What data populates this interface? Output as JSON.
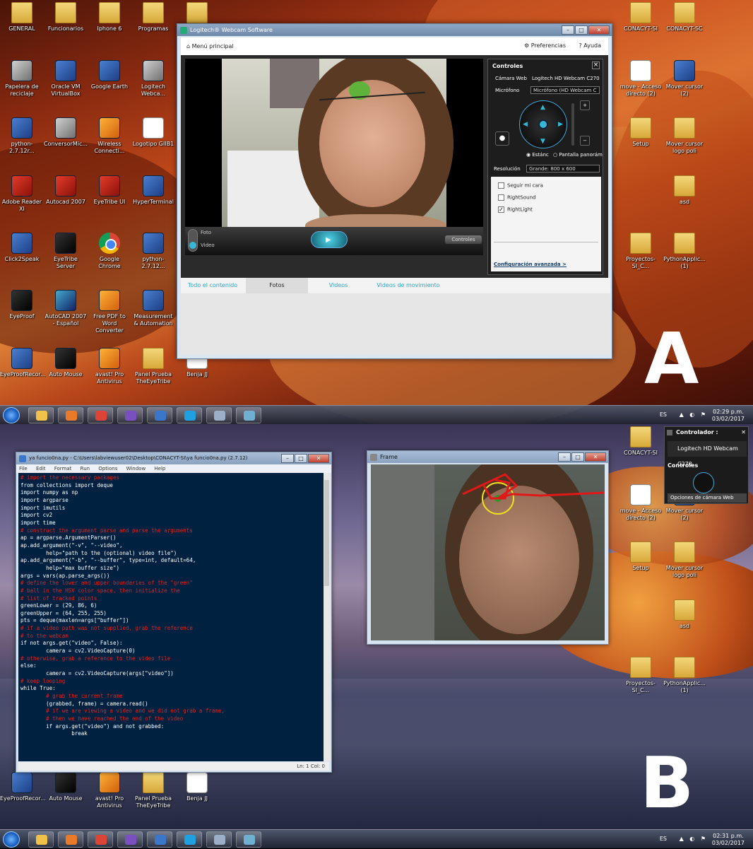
{
  "panel_a": {
    "label": "A",
    "desktop_icons": [
      {
        "label": "GENERAL",
        "type": "folder"
      },
      {
        "label": "Funcionarios",
        "type": "folder"
      },
      {
        "label": "Iphone 6",
        "type": "folder"
      },
      {
        "label": "Programas",
        "type": "folder"
      },
      {
        "label": "",
        "type": "folder"
      },
      {
        "label": "Papelera de reciclaje",
        "type": "gray"
      },
      {
        "label": "Oracle VM VirtualBox",
        "type": "app"
      },
      {
        "label": "Google Earth",
        "type": "app"
      },
      {
        "label": "Logitech Webca...",
        "type": "gray"
      },
      {
        "label": "python-2.7.12r...",
        "type": "app"
      },
      {
        "label": "ConversorMic...",
        "type": "gray"
      },
      {
        "label": "Wireless Connecti...",
        "type": "orange"
      },
      {
        "label": "Logotipo GIIB1",
        "type": "doc"
      },
      {
        "label": "Adobe Reader XI",
        "type": "red"
      },
      {
        "label": "Autocad 2007",
        "type": "red"
      },
      {
        "label": "EyeTribe UI",
        "type": "red"
      },
      {
        "label": "HyperTerminal",
        "type": "app"
      },
      {
        "label": "Click2Speak",
        "type": "app"
      },
      {
        "label": "EyeTribe Server",
        "type": "dark"
      },
      {
        "label": "Google Chrome",
        "type": "chrome"
      },
      {
        "label": "python-2.7.12...",
        "type": "app"
      },
      {
        "label": "EyeProof",
        "type": "dark"
      },
      {
        "label": "AutoCAD 2007 - Español",
        "type": "teal"
      },
      {
        "label": "Free PDF to Word Converter",
        "type": "orange"
      },
      {
        "label": "Measurement & Automation",
        "type": "app"
      },
      {
        "label": "EyeProofRecor...",
        "type": "app"
      },
      {
        "label": "Auto Mouse",
        "type": "dark"
      },
      {
        "label": "avast! Pro Antivirus",
        "type": "orange"
      },
      {
        "label": "Panel Prueba TheEyeTribe",
        "type": "folder"
      },
      {
        "label": "Benja JJ",
        "type": "doc"
      },
      {
        "label": "CONACYT-SI",
        "type": "folder"
      },
      {
        "label": "CONACYT-SC",
        "type": "folder"
      },
      {
        "label": "move - Acceso directo (2)",
        "type": "doc"
      },
      {
        "label": "Mover cursor (2)",
        "type": "app"
      },
      {
        "label": "Setup",
        "type": "folder"
      },
      {
        "label": "Mover cursor logo poli",
        "type": "folder"
      },
      {
        "label": "asd",
        "type": "folder"
      },
      {
        "label": "Proyectos-SI_C...",
        "type": "folder"
      },
      {
        "label": "PythonApplic... (1)",
        "type": "folder"
      }
    ],
    "logitech": {
      "title": "Logitech® Webcam Software",
      "menu_home": "Menú principal",
      "preferences": "Preferencias",
      "help": "Ayuda",
      "mode_photo": "Foto",
      "mode_video": "Video",
      "controls_button": "Controles",
      "controls_panel": {
        "title": "Controles",
        "camera_label": "Cámara Web",
        "camera_value": "Logitech HD Webcam C270",
        "mic_label": "Micrófono",
        "mic_value": "Micrófono (HD Webcam C",
        "standard": "Estánc",
        "panoramic": "Pantalla panorám",
        "resolution_label": "Resolución",
        "resolution_value": "Grande: 800 x 600",
        "follow_face": "Seguir mi cara",
        "rightsound": "RightSound",
        "rightlight": "RightLight",
        "advanced": "Configuración avanzada >"
      },
      "tabs": [
        "Todo el contenido",
        "Fotos",
        "Videos",
        "Videos de movimiento"
      ]
    },
    "tray": {
      "lang": "ES",
      "time": "02:29 p.m.",
      "date": "03/02/2017"
    }
  },
  "panel_b": {
    "label": "B",
    "idle": {
      "title": "ya funcio0na.py - C:\\Users\\labviewuser02\\Desktop\\CONACYT-SI\\ya funcio0na.py (2.7.12)",
      "menu": [
        "File",
        "Edit",
        "Format",
        "Run",
        "Options",
        "Window",
        "Help"
      ],
      "status": "Ln: 1   Col: 0",
      "code_lines": [
        "# import the necessary packages",
        "from collections import deque",
        "import numpy as np",
        "import argparse",
        "import imutils",
        "import cv2",
        "import time",
        "",
        "# construct the argument parse and parse the arguments",
        "ap = argparse.ArgumentParser()",
        "ap.add_argument(\"-v\", \"--video\",",
        "        help=\"path to the (optional) video file\")",
        "ap.add_argument(\"-b\", \"--buffer\", type=int, default=64,",
        "        help=\"max buffer size\")",
        "args = vars(ap.parse_args())",
        "",
        "# define the lower and upper boundaries of the \"green\"",
        "# ball in the HSV color space, then initialize the",
        "# list of tracked points",
        "greenLower = (29, 86, 6)",
        "greenUpper = (64, 255, 255)",
        "pts = deque(maxlen=args[\"buffer\"])",
        "",
        "# if a video path was not supplied, grab the reference",
        "# to the webcam",
        "if not args.get(\"video\", False):",
        "        camera = cv2.VideoCapture(0)",
        "# otherwise, grab a reference to the video file",
        "else:",
        "        camera = cv2.VideoCapture(args[\"video\"])",
        "# keep looping",
        "while True:",
        "        # grab the current frame",
        "        (grabbed, frame) = camera.read()",
        "",
        "        # if we are viewing a video and we did not grab a frame,",
        "        # then we have reached the end of the video",
        "        if args.get(\"video\") and not grabbed:",
        "                break"
      ]
    },
    "frame_window": {
      "title": "Frame"
    },
    "controller": {
      "title": "Controlador :",
      "device": "Logitech HD Webcam C270",
      "controls": "Controles",
      "options": "Opciones de cámara Web"
    },
    "desktop_icons": [
      {
        "label": "EyeProofRecor...",
        "type": "app"
      },
      {
        "label": "Auto Mouse",
        "type": "dark"
      },
      {
        "label": "avast! Pro Antivirus",
        "type": "orange"
      },
      {
        "label": "Panel Prueba TheEyeTribe",
        "type": "folder"
      },
      {
        "label": "Benja JJ",
        "type": "doc"
      },
      {
        "label": "CONACYT-SI",
        "type": "folder"
      },
      {
        "label": "move - Acceso directo (2)",
        "type": "doc"
      },
      {
        "label": "Mover cursor (2)",
        "type": "app"
      },
      {
        "label": "Setup",
        "type": "folder"
      },
      {
        "label": "Mover cursor logo poli",
        "type": "folder"
      },
      {
        "label": "asd",
        "type": "folder"
      },
      {
        "label": "Proyectos-SI_C...",
        "type": "folder"
      },
      {
        "label": "PythonApplic... (1)",
        "type": "folder"
      }
    ],
    "tray": {
      "lang": "ES",
      "time": "02:31 p.m.",
      "date": "03/02/2017"
    }
  },
  "taskbar_apps": [
    "explorer",
    "media-player",
    "chrome",
    "visual-studio",
    "python",
    "skype",
    "paint",
    "webcam"
  ]
}
